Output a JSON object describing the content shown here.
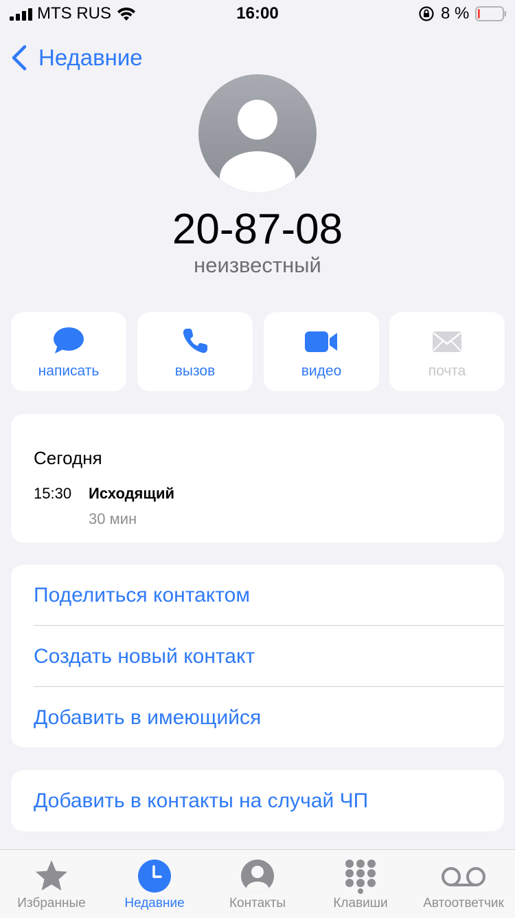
{
  "status_bar": {
    "carrier": "MTS RUS",
    "time": "16:00",
    "battery": "8 %",
    "battery_level": 0.08,
    "battery_color": "#ff3b30"
  },
  "nav": {
    "back_label": "Недавние"
  },
  "contact": {
    "number": "20-87-08",
    "subtitle": "неизвестный"
  },
  "actions": [
    {
      "label": "написать",
      "icon": "message-bubble-icon",
      "enabled": true
    },
    {
      "label": "вызов",
      "icon": "phone-icon",
      "enabled": true
    },
    {
      "label": "видео",
      "icon": "video-camera-icon",
      "enabled": true
    },
    {
      "label": "почта",
      "icon": "mail-envelope-icon",
      "enabled": false
    }
  ],
  "history": {
    "day": "Сегодня",
    "entries": [
      {
        "time": "15:30",
        "type": "Исходящий",
        "duration": "30 мин"
      }
    ]
  },
  "options": [
    {
      "label": "Поделиться контактом"
    },
    {
      "label": "Создать новый контакт"
    },
    {
      "label": "Добавить в имеющийся"
    }
  ],
  "emergency": {
    "label": "Добавить в контакты на случай ЧП"
  },
  "tabs": [
    {
      "label": "Избранные",
      "icon": "star-icon",
      "active": false
    },
    {
      "label": "Недавние",
      "icon": "clock-icon",
      "active": true
    },
    {
      "label": "Контакты",
      "icon": "person-circle-icon",
      "active": false
    },
    {
      "label": "Клавиши",
      "icon": "keypad-icon",
      "active": false
    },
    {
      "label": "Автоответчик",
      "icon": "voicemail-icon",
      "active": false
    }
  ],
  "colors": {
    "accent": "#2f7af6",
    "background": "#f2f2f7",
    "inactive": "#8e8e93",
    "disabled": "#c7c7cc"
  }
}
